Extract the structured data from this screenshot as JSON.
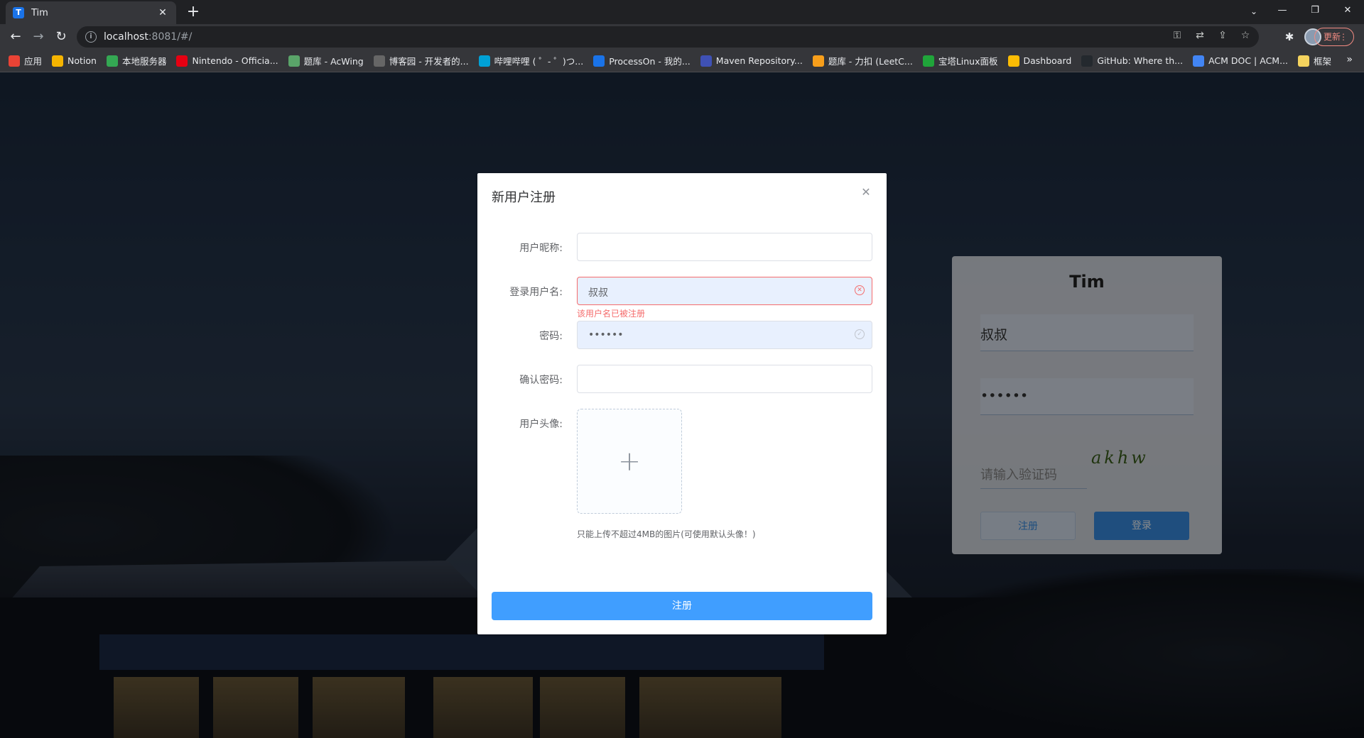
{
  "browser": {
    "tab_title": "Tim",
    "tab_favicon": "T",
    "url_host": "localhost",
    "url_rest": ":8081/#/",
    "update_label": "更新",
    "bookmarks": [
      {
        "label": "应用",
        "icon": "apps-icon",
        "color": "#ea4335"
      },
      {
        "label": "Notion",
        "icon": "notion-icon",
        "color": "#f5b400"
      },
      {
        "label": "本地服务器",
        "icon": "server-icon",
        "color": "#34a853"
      },
      {
        "label": "Nintendo - Officia...",
        "icon": "nintendo-icon",
        "color": "#e60012"
      },
      {
        "label": "题库 - AcWing",
        "icon": "acwing-icon",
        "color": "#5aa469"
      },
      {
        "label": "博客园 - 开发者的...",
        "icon": "cnblogs-icon",
        "color": "#666666"
      },
      {
        "label": "哔哩哔哩 ( ゜- ゜)つ...",
        "icon": "bilibili-icon",
        "color": "#00a1d6"
      },
      {
        "label": "ProcessOn - 我的...",
        "icon": "processon-icon",
        "color": "#1a73e8"
      },
      {
        "label": "Maven Repository...",
        "icon": "maven-icon",
        "color": "#3f51b5"
      },
      {
        "label": "题库 - 力扣 (LeetC...",
        "icon": "leetcode-icon",
        "color": "#f89f1b"
      },
      {
        "label": "宝塔Linux面板",
        "icon": "bt-icon",
        "color": "#20a53a"
      },
      {
        "label": "Dashboard",
        "icon": "dashboard-icon",
        "color": "#fbbc04"
      },
      {
        "label": "GitHub: Where th...",
        "icon": "github-icon",
        "color": "#24292e"
      },
      {
        "label": "ACM DOC | ACM...",
        "icon": "acm-icon",
        "color": "#4285f4"
      },
      {
        "label": "框架",
        "icon": "folder-icon",
        "color": "#f4d35e"
      }
    ]
  },
  "login_card": {
    "title": "Tim",
    "username_value": "叔叔",
    "password_value": "••••••",
    "captcha_placeholder": "请输入验证码",
    "captcha_text": "akhw",
    "register_label": "注册",
    "login_label": "登录"
  },
  "dialog": {
    "title": "新用户注册",
    "fields": {
      "nickname_label": "用户昵称:",
      "nickname_value": "",
      "username_label": "登录用户名:",
      "username_value": "叔叔",
      "username_error": "该用户名已被注册",
      "password_label": "密码:",
      "password_value": "••••••",
      "confirm_label": "确认密码:",
      "confirm_value": "",
      "avatar_label": "用户头像:"
    },
    "upload_tip": "只能上传不超过4MB的图片(可使用默认头像！)",
    "submit_label": "注册"
  },
  "colors": {
    "primary": "#409eff",
    "error": "#f56c6c"
  }
}
